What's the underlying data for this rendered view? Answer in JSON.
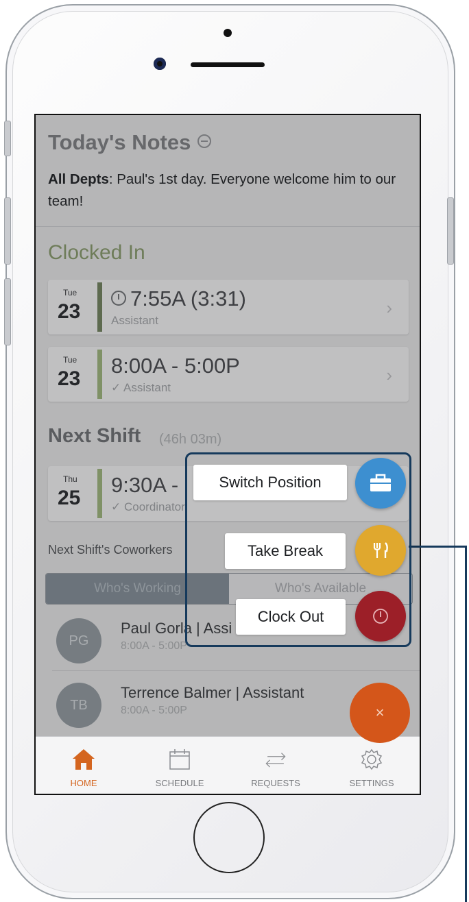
{
  "notes": {
    "title": "Today's Notes",
    "dept": "All Depts",
    "message": ": Paul's 1st day. Everyone welcome him to our team!"
  },
  "clocked_in": {
    "title": "Clocked In",
    "cards": [
      {
        "dow": "Tue",
        "day": "23",
        "time": "7:55A (3:31)",
        "sub": "Assistant",
        "bar_color": "#6f7f5f"
      },
      {
        "dow": "Tue",
        "day": "23",
        "time": "8:00A - 5:00P",
        "sub": "✓ Assistant",
        "bar_color": "#98ad7a"
      }
    ]
  },
  "next_shift": {
    "title": "Next Shift",
    "countdown": "(46h 03m)",
    "card": {
      "dow": "Thu",
      "day": "25",
      "time": "9:30A - ",
      "sub": "✓ Coordinator",
      "bar_color": "#98ad7a"
    }
  },
  "coworkers": {
    "label": "Next Shift's Coworkers",
    "seg_working": "Who's Working",
    "seg_available": "Who's Available",
    "people": [
      {
        "initials": "PG",
        "name": "Paul Gorla | Assi",
        "hours": "8:00A - 5:00P"
      },
      {
        "initials": "TB",
        "name": "Terrence Balmer | Assistant",
        "hours": "8:00A - 5:00P"
      }
    ]
  },
  "fab_menu": {
    "switch_position": "Switch Position",
    "take_break": "Take Break",
    "clock_out": "Clock Out",
    "close": "×",
    "colors": {
      "switch": "#3d8fd0",
      "break": "#e0a82e",
      "clockout": "#9c1f28",
      "main": "#d4561a"
    }
  },
  "tabs": {
    "home": "HOME",
    "schedule": "SCHEDULE",
    "requests": "REQUESTS",
    "settings": "SETTINGS"
  },
  "accent": "#d4651f"
}
